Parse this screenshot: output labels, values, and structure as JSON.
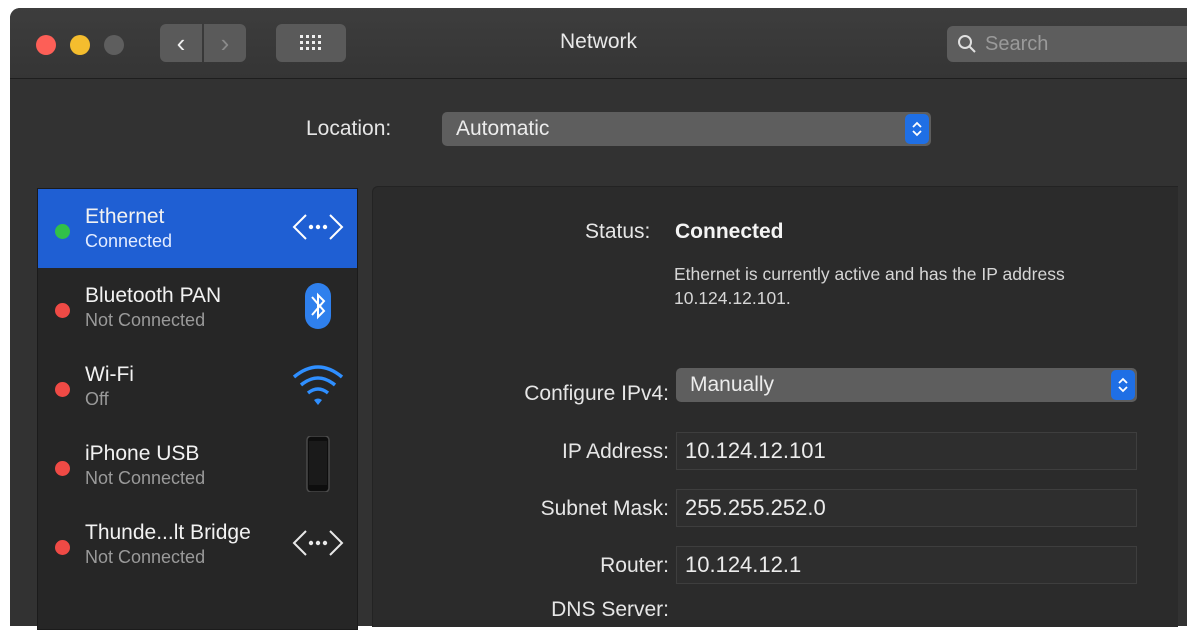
{
  "window": {
    "title": "Network"
  },
  "toolbar": {
    "back_glyph": "‹",
    "forward_glyph": "›",
    "search_placeholder": "Search"
  },
  "location": {
    "label": "Location:",
    "value": "Automatic"
  },
  "services": [
    {
      "name": "Ethernet",
      "status": "Connected",
      "indicator": "green",
      "icon": "ethernet-arrows-icon",
      "selected": true
    },
    {
      "name": "Bluetooth PAN",
      "status": "Not Connected",
      "indicator": "red",
      "icon": "bluetooth-icon",
      "selected": false
    },
    {
      "name": "Wi-Fi",
      "status": "Off",
      "indicator": "red",
      "icon": "wifi-icon",
      "selected": false
    },
    {
      "name": "iPhone USB",
      "status": "Not Connected",
      "indicator": "red",
      "icon": "iphone-icon",
      "selected": false
    },
    {
      "name": "Thunde...lt Bridge",
      "status": "Not Connected",
      "indicator": "red",
      "icon": "ethernet-arrows-icon",
      "selected": false
    }
  ],
  "detail": {
    "status_label": "Status:",
    "status_value": "Connected",
    "status_description": "Ethernet is currently active and has the IP address 10.124.12.101.",
    "configure_ipv4_label": "Configure IPv4:",
    "configure_ipv4_value": "Manually",
    "ip_address_label": "IP Address:",
    "ip_address_value": "10.124.12.101",
    "subnet_mask_label": "Subnet Mask:",
    "subnet_mask_value": "255.255.252.0",
    "router_label": "Router:",
    "router_value": "10.124.12.1",
    "dns_server_label": "DNS Server:"
  },
  "colors": {
    "window_bg": "#323232",
    "selection": "#1f5fd3",
    "accent_stepper": "#1f6fe5",
    "status_green": "#31c048",
    "status_red": "#ef4a45"
  }
}
